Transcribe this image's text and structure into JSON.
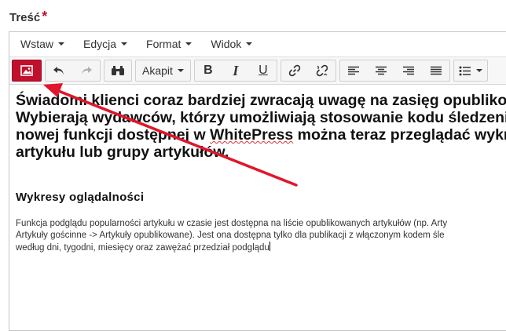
{
  "field": {
    "label": "Treść",
    "required_mark": "*"
  },
  "menubar": {
    "insert": "Wstaw",
    "edit": "Edycja",
    "format": "Format",
    "view": "Widok"
  },
  "toolbar": {
    "block_format": "Akapit",
    "bold": "B",
    "italic": "I",
    "underline": "U"
  },
  "content": {
    "lead": {
      "line1": "Świadomi klienci coraz bardziej zwracają uwagę na zasięg opubliko",
      "line2": "Wybierają wydawców, którzy umożliwiają stosowanie kodu śledzeni",
      "line3_a": "nowej funkcji dostępnej w ",
      "line3_b": "WhitePress",
      "line3_c": " można teraz przeglądać wykr",
      "line4": "artykułu lub grupy artykułów."
    },
    "heading": "Wykresy oglądalności",
    "para": {
      "line1": "Funkcja podglądu popularności artykułu w czasie jest dostępna na liście opublikowanych artykułów (np. Arty",
      "line2": "Artykuły gościnne -> Artykuły opublikowane). Jest ona dostępna tylko dla publikacji z włączonym kodem śle",
      "line3": "według dni, tygodni, miesięcy oraz zawężać przedział podglądu"
    }
  },
  "colors": {
    "accent": "#c0102e",
    "arrow": "#e0162b",
    "border": "#c5c5c5"
  }
}
